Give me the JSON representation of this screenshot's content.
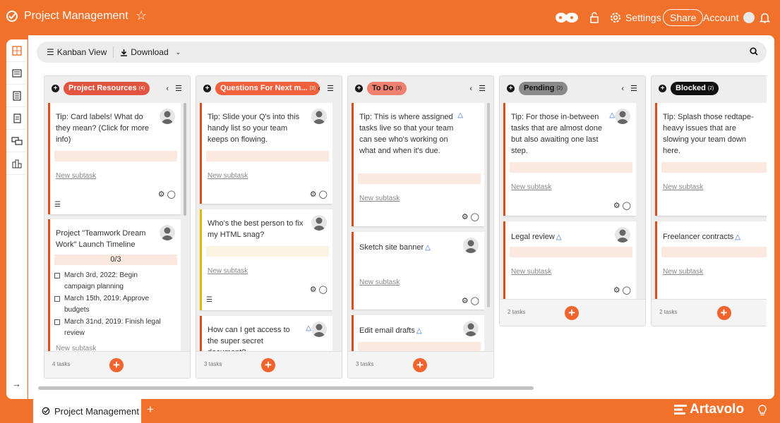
{
  "app": {
    "title": "Project Management"
  },
  "header": {
    "settings_label": "Settings",
    "share_label": "Share",
    "account_label": "Account"
  },
  "toolbar": {
    "view_label": "Kanban View",
    "download_label": "Download"
  },
  "colors": {
    "accent": "#f1702a",
    "card_edge_red": "#e04a1f",
    "card_edge_yellow": "#e0b800",
    "add_button": "#f2642b"
  },
  "columns": [
    {
      "name": "Project Resources",
      "count": "(4)",
      "pill_bg": "#e2543f",
      "pill_fg": "#ffffff",
      "footer": "4 tasks",
      "cards": [
        {
          "title": "Tip: Card labels! What do they mean? (Click for more info)",
          "subtask": "New subtask"
        },
        {
          "title": "Project \"Teamwork Dream Work\" Launch Timeline",
          "progress": "0/3",
          "checklist": [
            "March 3rd, 2022: Begin campaign planning",
            "March 15th, 2019: Approve budgets",
            "March 31nd, 2019: Finish legal review"
          ],
          "subtask": "New subtask"
        }
      ]
    },
    {
      "name": "Questions For Next m...",
      "count": "(3)",
      "pill_bg": "#f0603a",
      "pill_fg": "#ffffff",
      "footer": "3 tasks",
      "cards": [
        {
          "title": "Tip: Slide your Q's into this handy list so your team keeps on flowing.",
          "subtask": "New subtask"
        },
        {
          "title": "Who's the best person to fix my HTML snag?",
          "subtask": "New subtask"
        },
        {
          "title": "How can I get access to the super secret document?"
        }
      ]
    },
    {
      "name": "To Do",
      "count": "(3)",
      "pill_bg": "#f08070",
      "pill_fg": "#1a1a1a",
      "footer": "3 tasks",
      "cards": [
        {
          "title": "Tip: This is where assigned tasks live so that your team can see who's working on what and when it's due.",
          "subtask": "New subtask"
        },
        {
          "title": "Sketch site banner",
          "subtask": "New subtask"
        },
        {
          "title": "Edit email drafts"
        }
      ]
    },
    {
      "name": "Pending",
      "count": "(2)",
      "pill_bg": "#8a8a8a",
      "pill_fg": "#111111",
      "footer": "2 tasks",
      "cards": [
        {
          "title": "Tip: For those in-between tasks that are almost done but also awaiting one last step.",
          "subtask": "New subtask"
        },
        {
          "title": "Legal review",
          "subtask": "New subtask"
        }
      ]
    },
    {
      "name": "Blocked",
      "count": "(2)",
      "pill_bg": "#111111",
      "pill_fg": "#ffffff",
      "footer": "2 tasks",
      "cards": [
        {
          "title": "Tip: Splash those redtape-heavy issues that are slowing your team down here.",
          "subtask": "New subtask"
        },
        {
          "title": "Freelancer contracts",
          "subtask": "New subtask"
        }
      ]
    }
  ],
  "bottom": {
    "tab_label": "Project Management",
    "brand": "Artavolo"
  }
}
